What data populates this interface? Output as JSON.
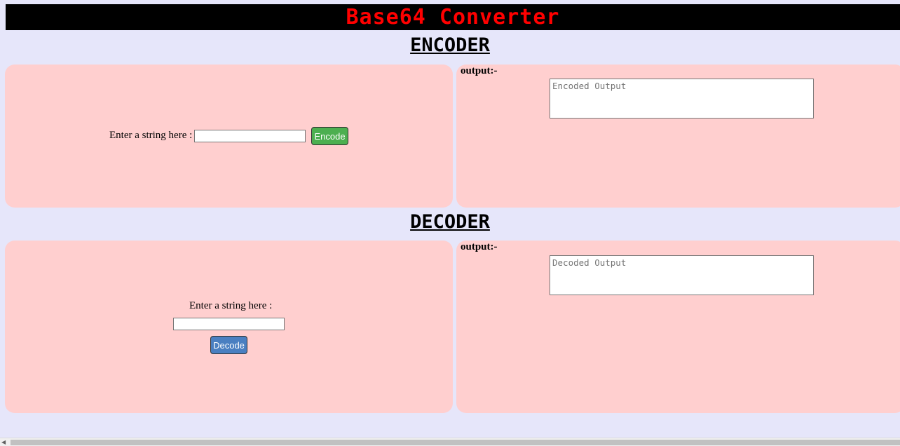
{
  "header": {
    "title": "Base64 Converter"
  },
  "encoder": {
    "section_title": "ENCODER",
    "input_label": "Enter a string here :",
    "input_value": "",
    "button_label": "Encode",
    "output_label": "output:-",
    "output_placeholder": "Encoded Output",
    "button_color": "#4caf50"
  },
  "decoder": {
    "section_title": "DECODER",
    "input_label": "Enter a string here :",
    "input_value": "",
    "button_label": "Decode",
    "output_label": "output:-",
    "output_placeholder": "Decoded Output",
    "button_color": "#4a7fc1"
  },
  "colors": {
    "background": "#e6e6fa",
    "panel": "#ffcfcf",
    "header_bg": "#000000",
    "header_text": "#ff0000"
  },
  "scrollbar": {
    "left_arrow_icon": "scroll-left-arrow-icon"
  }
}
